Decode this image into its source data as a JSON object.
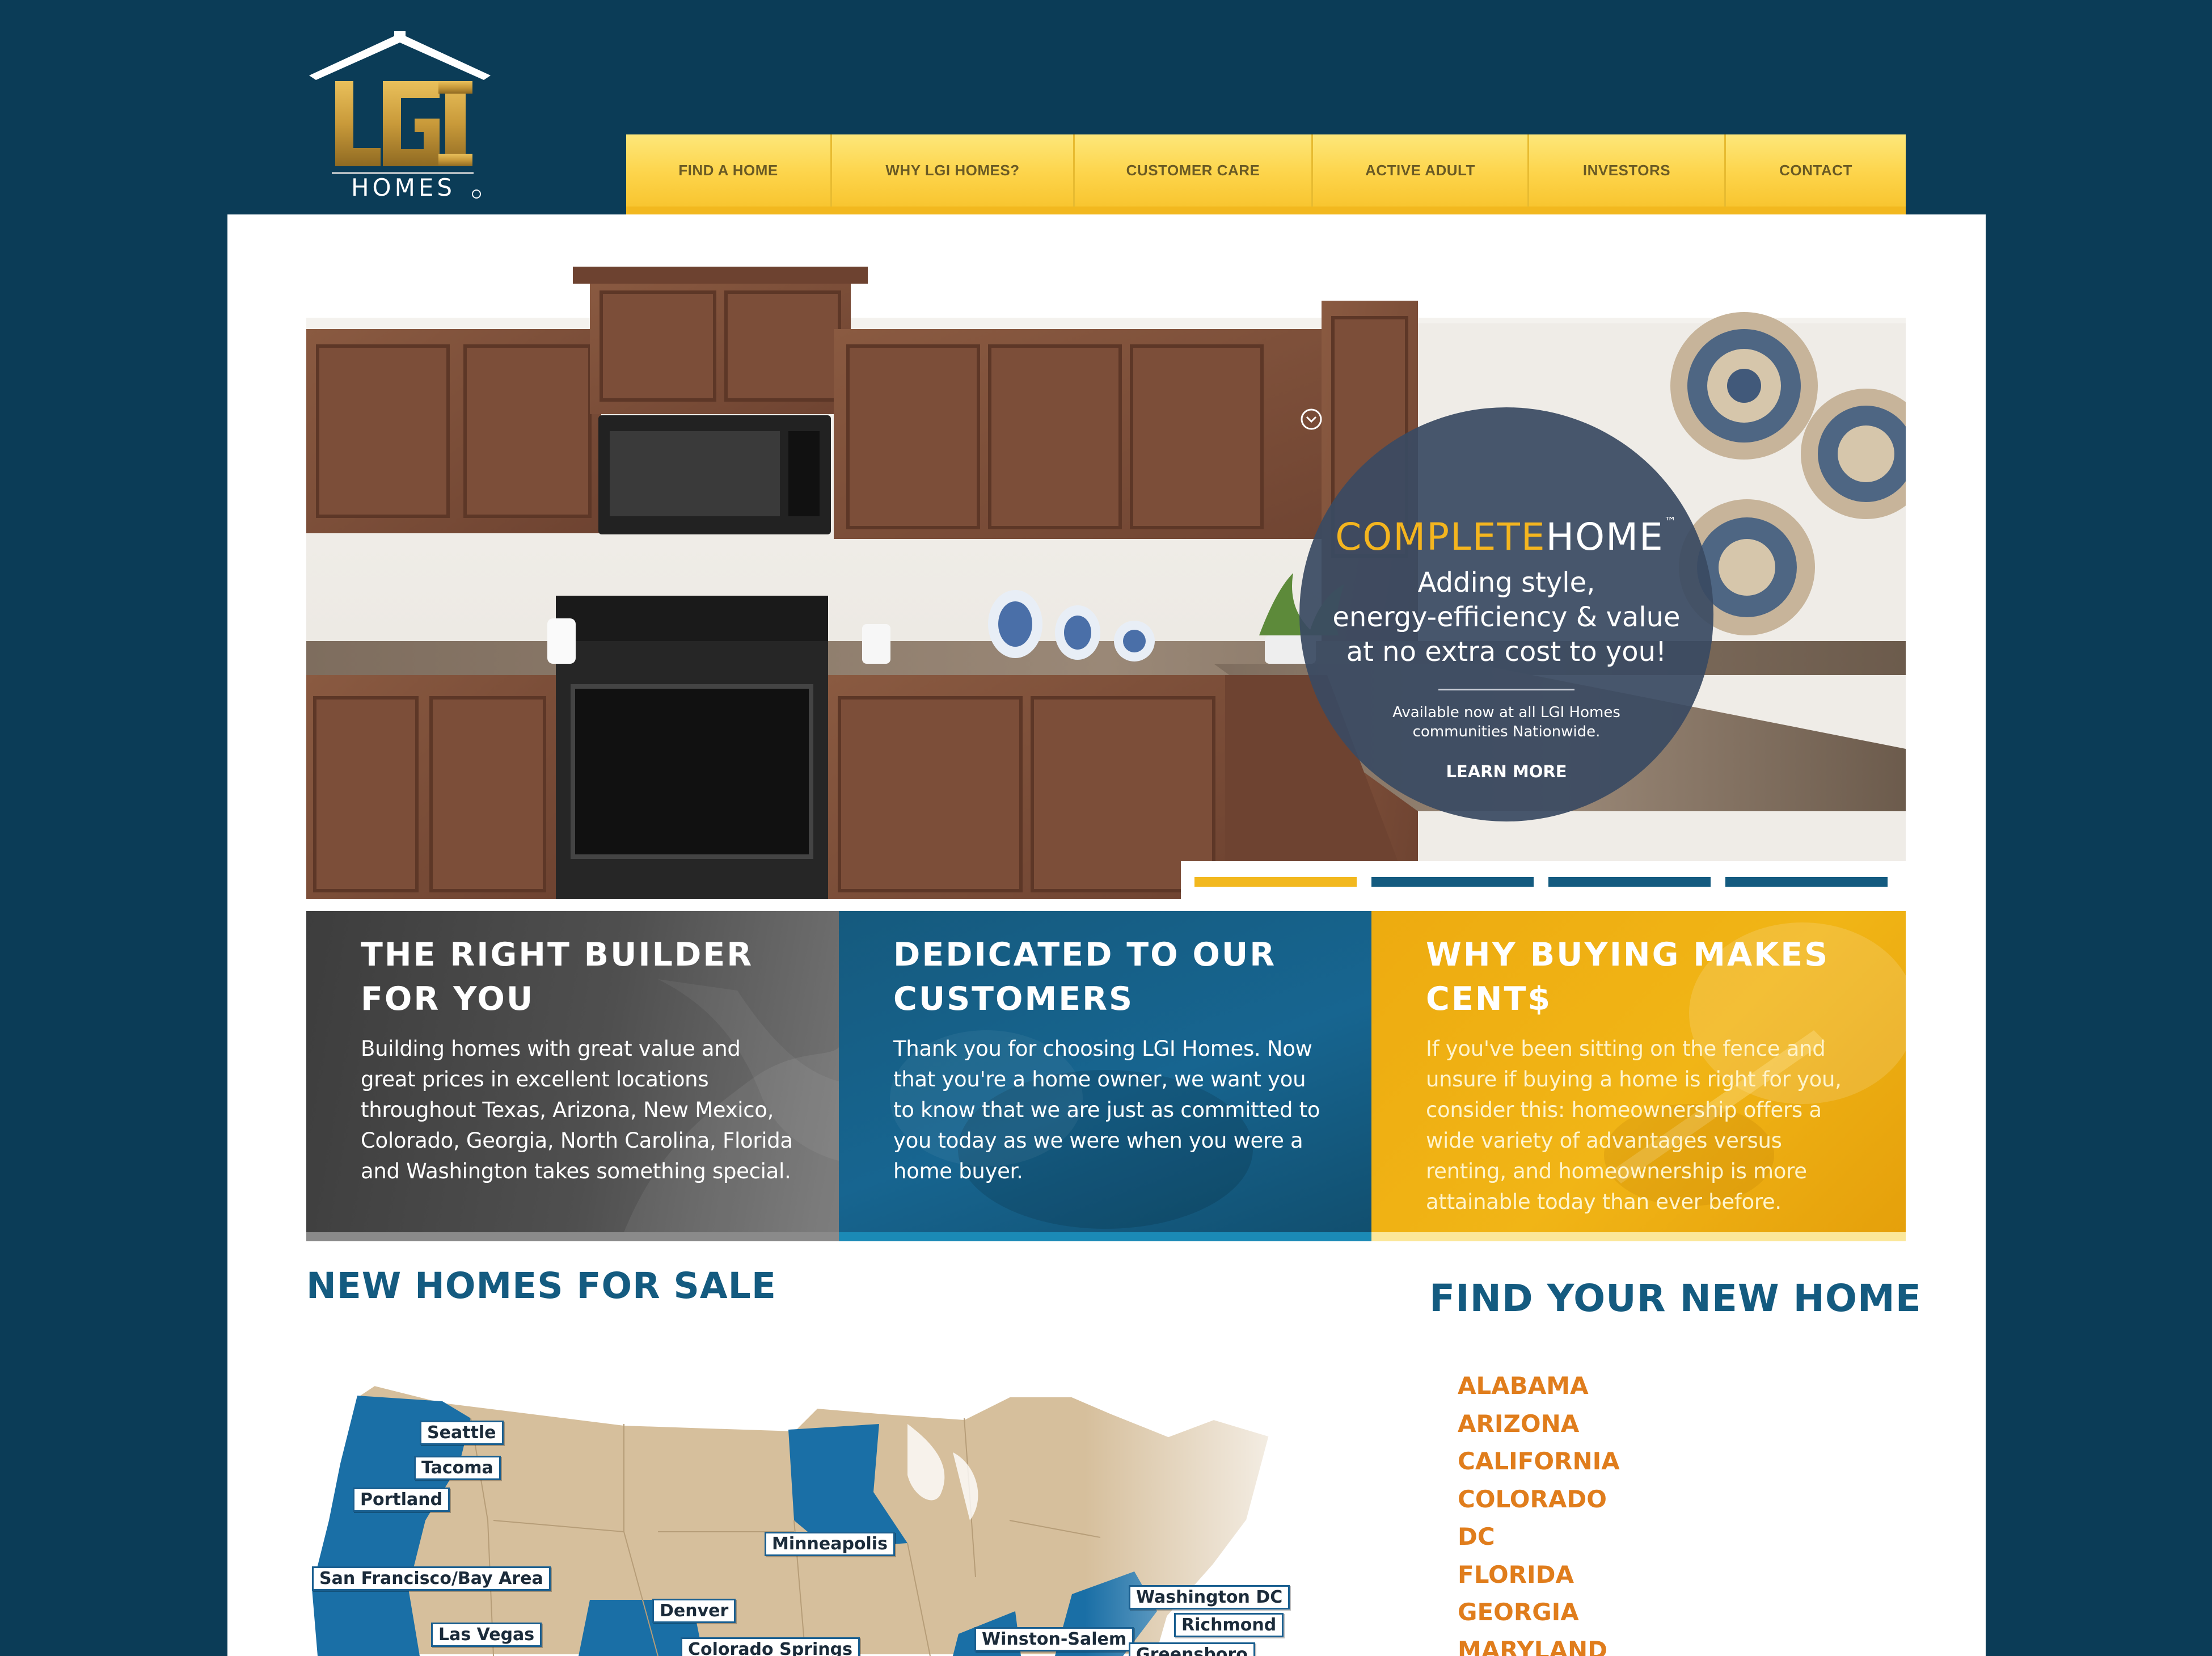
{
  "logo": {
    "top": "LGI",
    "bottom": "HOMES"
  },
  "nav": [
    {
      "label": "FIND A HOME"
    },
    {
      "label": "WHY LGI HOMES?"
    },
    {
      "label": "CUSTOMER CARE"
    },
    {
      "label": "ACTIVE ADULT"
    },
    {
      "label": "INVESTORS"
    },
    {
      "label": "CONTACT"
    }
  ],
  "hero": {
    "promo": {
      "brand_a": "COMPLETE",
      "brand_b": "HOME",
      "tm": "™",
      "line1": "Adding style,",
      "line2": "energy-efficiency & value",
      "line3": "at no extra cost to you!",
      "small1": "Available now at all LGI Homes",
      "small2": "communities Nationwide.",
      "learn_more": "LEARN MORE"
    },
    "slide_indicators": {
      "count": 4,
      "active_index": 0
    }
  },
  "panels": [
    {
      "title_line1": "THE RIGHT BUILDER",
      "title_line2": "FOR YOU",
      "body": "Building homes with great value and great prices in excellent locations throughout Texas, Arizona, New Mexico, Colorado, Georgia, North Carolina, Florida and Washington takes something special."
    },
    {
      "title_line1": "DEDICATED TO OUR",
      "title_line2": "CUSTOMERS",
      "body": "Thank you for choosing LGI Homes. Now that you're a home owner, we want you to know that we are just as committed to you today as we were when you were a home buyer."
    },
    {
      "title_line1": "WHY BUYING MAKES",
      "title_line2": "CENT$",
      "body": "If you've been sitting on the fence and unsure if buying a home is right for you, consider this: homeownership offers a wide variety of advantages versus renting, and homeownership is more attainable today than ever before."
    }
  ],
  "new_homes": {
    "title": "NEW HOMES FOR SALE",
    "cities": [
      "Seattle",
      "Tacoma",
      "Portland",
      "San Francisco/Bay Area",
      "Las Vegas",
      "Minneapolis",
      "Denver",
      "Colorado Springs",
      "Washington DC",
      "Richmond",
      "Winston-Salem",
      "Greensboro"
    ]
  },
  "find_home": {
    "title": "FIND YOUR NEW HOME",
    "states": [
      "ALABAMA",
      "ARIZONA",
      "CALIFORNIA",
      "COLORADO",
      "DC",
      "FLORIDA",
      "GEORGIA",
      "MARYLAND"
    ]
  },
  "colors": {
    "background": "#0b3c57",
    "nav_gold": "#fdd44a",
    "panel_dark": "#4a4a4a",
    "panel_blue": "#176590",
    "panel_gold": "#f1b516",
    "heading_blue": "#145b80",
    "state_orange": "#e07d1c",
    "map_blue": "#1a6fa6",
    "map_tan": "#d6bf9c"
  }
}
